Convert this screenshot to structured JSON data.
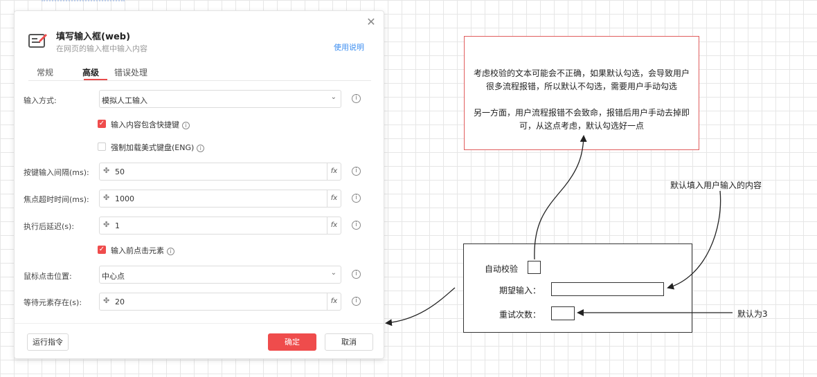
{
  "dialog": {
    "title": "填写输入框(web)",
    "subtitle": "在网页的输入框中输入内容",
    "help_link": "使用说明",
    "close_glyph": "✕",
    "tabs": [
      {
        "label": "常规",
        "active": false
      },
      {
        "label": "高级",
        "active": true
      },
      {
        "label": "错误处理",
        "active": false
      }
    ],
    "fields": {
      "input_method": {
        "label": "输入方式:",
        "value": "模拟人工输入"
      },
      "include_hotkeys": {
        "label": "输入内容包含快捷键",
        "checked": true
      },
      "force_us_keyboard": {
        "label": "强制加载美式键盘(ENG)",
        "checked": false
      },
      "key_interval": {
        "label": "按键输入间隔(ms):",
        "value": "50"
      },
      "focus_timeout": {
        "label": "焦点超时时间(ms):",
        "value": "1000"
      },
      "delay_after": {
        "label": "执行后延迟(s):",
        "value": "1"
      },
      "click_before": {
        "label": "输入前点击元素",
        "checked": true
      },
      "click_position": {
        "label": "鼠标点击位置:",
        "value": "中心点"
      },
      "wait_element": {
        "label": "等待元素存在(s):",
        "value": "20"
      }
    },
    "fx_label": "fx",
    "info_glyph": "i",
    "buttons": {
      "run": "运行指令",
      "ok": "确定",
      "cancel": "取消"
    }
  },
  "annotation": {
    "note_lines": [
      "考虑校验的文本可能会不正确，如果默认勾选，会导致用户很多流程报错，所以默认不勾选，需要用户手动勾选",
      "另一方面，用户流程报错不会致命，报错后用户手动去掉即可，从这点考虑，默认勾选好一点"
    ],
    "mock": {
      "auto_verify": "自动校验",
      "expected_input": "期望输入：",
      "retry_count": "重试次数："
    },
    "default_fill_note": "默认填入用户输入的内容",
    "default_three_note": "默认为3"
  },
  "colors": {
    "accent": "#ef4c4c",
    "link": "#3c8ef0",
    "note_border": "#e05c5c"
  }
}
